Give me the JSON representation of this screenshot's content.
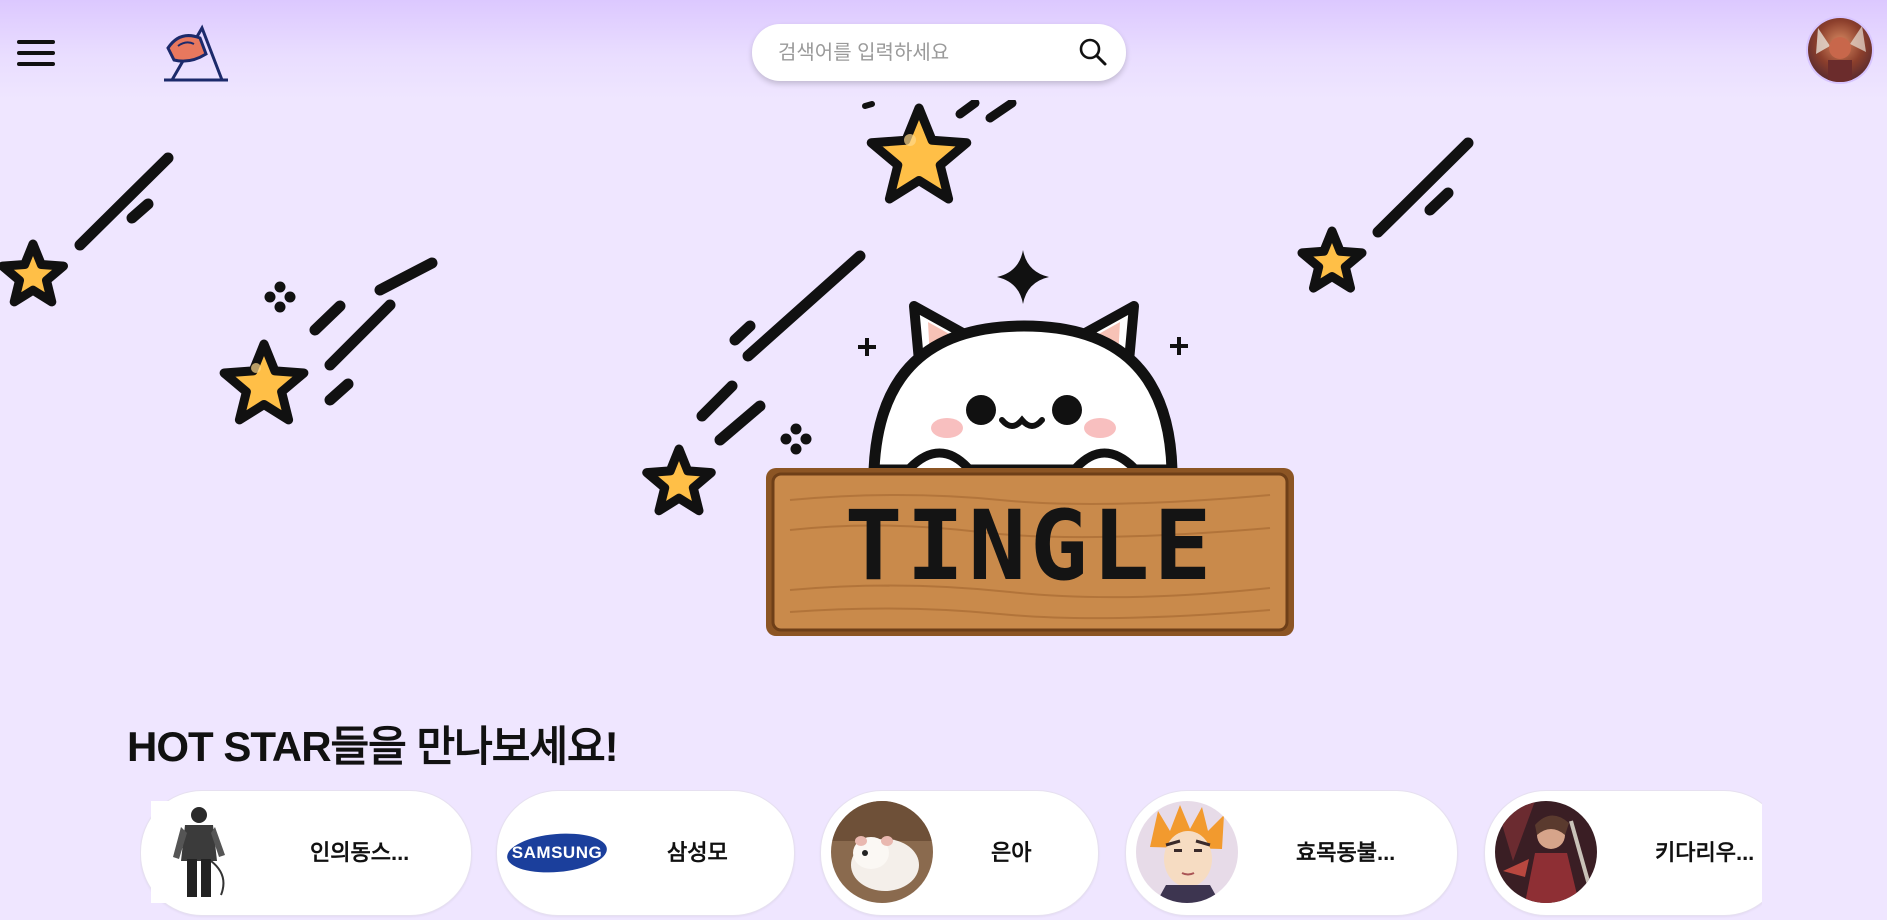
{
  "header": {
    "menu_icon": "hamburger-menu-icon",
    "logo_icon": "tingle-logo-icon",
    "search": {
      "placeholder": "검색어를 입력하세요",
      "value": "",
      "icon": "search-icon"
    },
    "profile_icon": "user-avatar"
  },
  "hero": {
    "sign_text": "TINGLE"
  },
  "hot_stars": {
    "title": "HOT STAR들을 만나보세요!",
    "cards": [
      {
        "name": "인의동스...",
        "thumb": "character-figure-thumbnail"
      },
      {
        "name": "삼성모",
        "thumb": "samsung-logo-thumbnail",
        "logo_text": "SAMSUNG"
      },
      {
        "name": "은아",
        "thumb": "hamster-thumbnail"
      },
      {
        "name": "효목동불...",
        "thumb": "anime-character-thumbnail"
      },
      {
        "name": "키다리우...",
        "thumb": "game-character-thumbnail"
      }
    ]
  },
  "colors": {
    "page_background": "#efe6ff",
    "header_top": "#dcc8ff",
    "star_fill": "#ffbf47",
    "sign_wood": "#c98a4b",
    "accent_navy": "#1c2a6b"
  }
}
